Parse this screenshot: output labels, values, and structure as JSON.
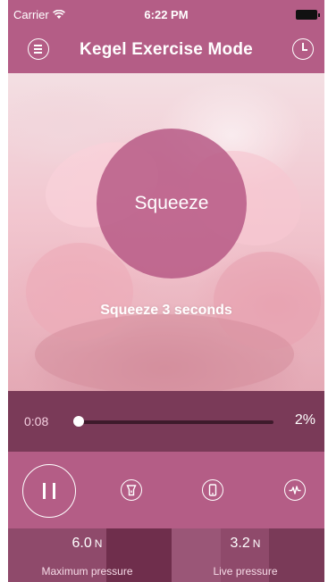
{
  "status_bar": {
    "carrier": "Carrier",
    "time": "6:22 PM"
  },
  "nav": {
    "title": "Kegel Exercise Mode",
    "left_icon": "menu-icon",
    "right_icon": "clock-icon"
  },
  "exercise": {
    "phase_label": "Squeeze",
    "instruction": "Squeeze 3 seconds"
  },
  "progress": {
    "elapsed": "0:08",
    "percent_label": "2%",
    "fraction": 0.02
  },
  "controls": {
    "icons": [
      "pause-icon",
      "flashlight-icon",
      "phone-icon",
      "pulse-icon"
    ]
  },
  "readouts": {
    "max": {
      "value": "6.0",
      "unit": "N",
      "label": "Maximum pressure"
    },
    "live": {
      "value": "3.2",
      "unit": "N",
      "label": "Live pressure"
    }
  },
  "colors": {
    "brand": "#b45d86",
    "dark_band": "#7a3a58",
    "readout_band": "#8f4a6b"
  }
}
